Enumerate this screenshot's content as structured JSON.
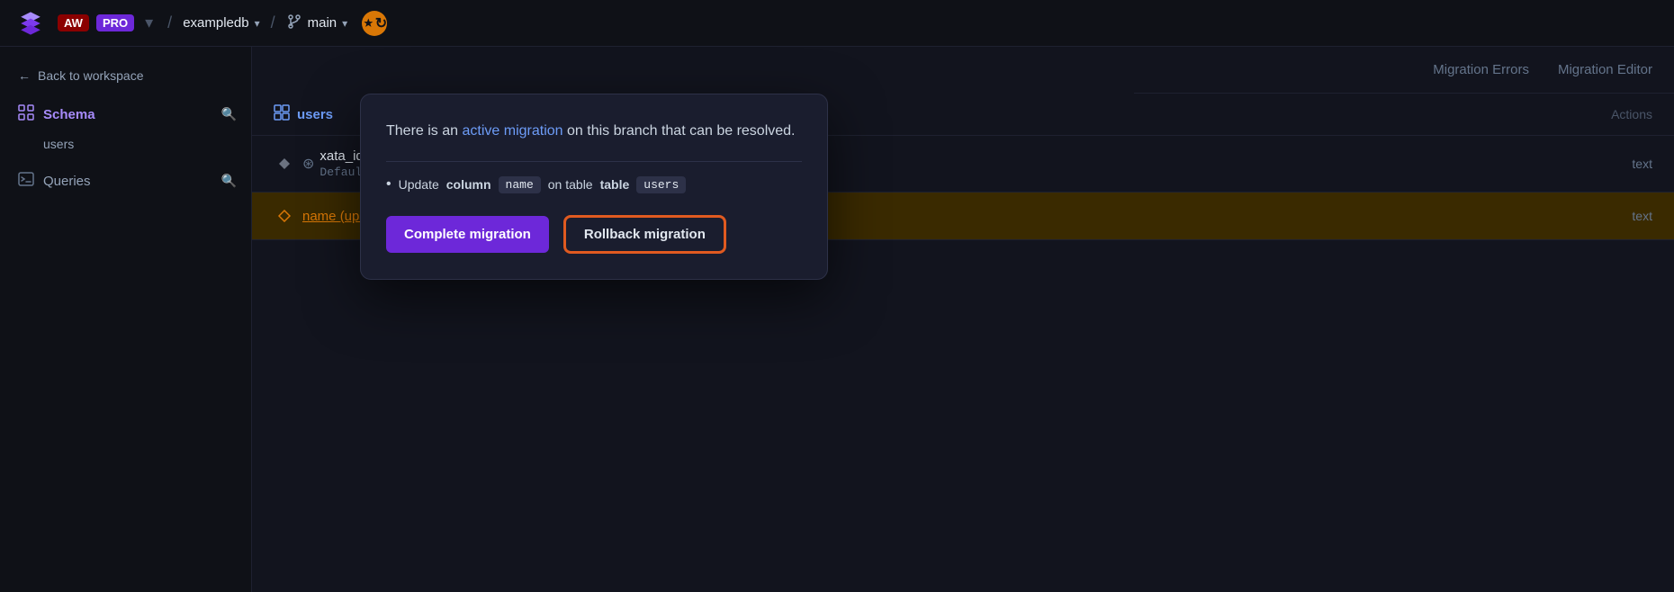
{
  "topbar": {
    "user_initials": "AW",
    "pro_label": "PRO",
    "separator1": "/",
    "db_name": "exampledb",
    "separator2": "/",
    "branch_name": "main",
    "chevron": "▾"
  },
  "sidebar": {
    "back_label": "Back to workspace",
    "schema_label": "Schema",
    "users_label": "users",
    "queries_label": "Queries"
  },
  "tabs": {
    "migration_errors_label": "Migration Errors",
    "migration_editor_label": "Migration Editor"
  },
  "table": {
    "name": "users",
    "actions_label": "Actions",
    "columns": [
      {
        "name": "xata_id",
        "type": "text",
        "default": "Default: ('rec_'::text || (xata_private.xid())::text)",
        "updated": false
      },
      {
        "name": "name (updated)",
        "type": "text",
        "default": "",
        "updated": true
      }
    ]
  },
  "popup": {
    "text_prefix": "There is an",
    "active_migration_link": "active migration",
    "text_suffix": "on this branch that can be resolved.",
    "bullet_prefix": "Update",
    "column_label": "column",
    "column_value": "name",
    "on_label": "on table",
    "table_value": "users",
    "complete_btn_label": "Complete migration",
    "rollback_btn_label": "Rollback migration"
  }
}
